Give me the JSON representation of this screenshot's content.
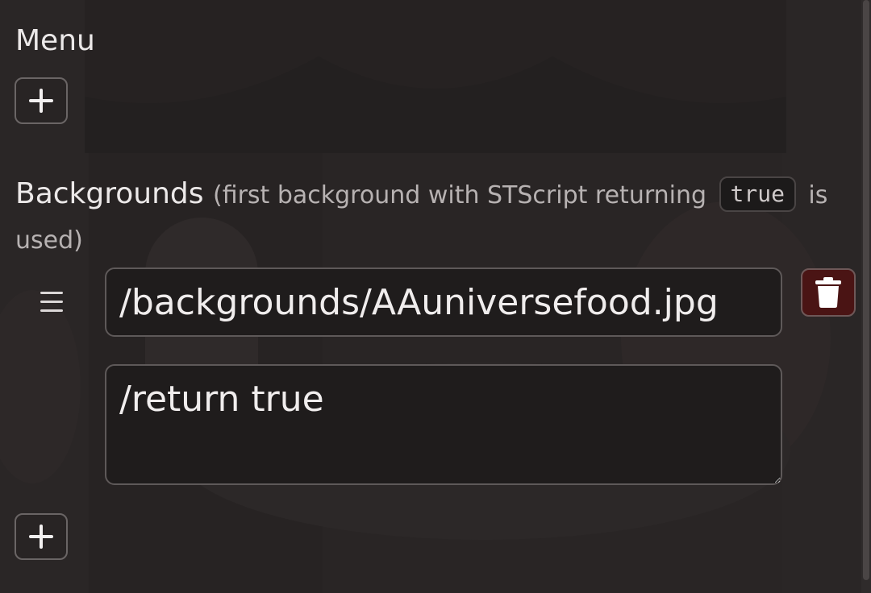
{
  "menu": {
    "title": "Menu",
    "add_icon": "plus-icon"
  },
  "backgrounds": {
    "title": "Backgrounds",
    "hint_before": "(first background with STScript returning",
    "hint_code": "true",
    "hint_after": "is used)",
    "items": [
      {
        "path": "/backgrounds/AAuniversefood.jpg",
        "script": "/return true"
      }
    ],
    "drag_icon": "hamburger-icon",
    "delete_icon": "trash-icon",
    "add_icon": "plus-icon"
  },
  "colors": {
    "panel": "#2a2626",
    "delete_bg": "#4a1414",
    "border": "#5e5959"
  }
}
